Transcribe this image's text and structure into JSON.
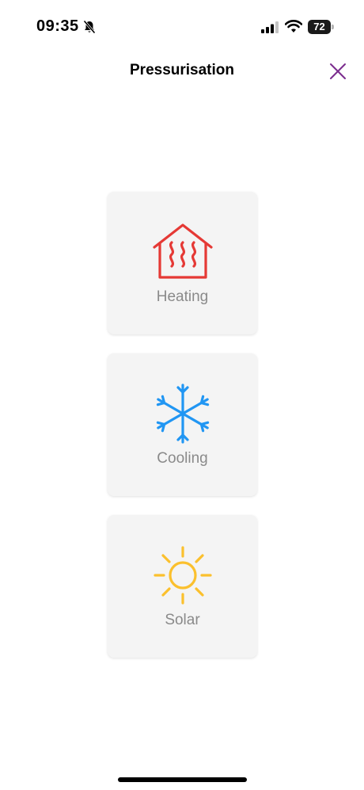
{
  "status_bar": {
    "time": "09:35",
    "battery_level": "72",
    "icons": [
      "bell-slash-icon",
      "signal-icon",
      "wifi-icon",
      "battery-icon"
    ]
  },
  "header": {
    "title": "Pressurisation",
    "close_icon": "close-icon"
  },
  "options": [
    {
      "label": "Heating",
      "icon": "house-heat-icon",
      "color": "#e53935"
    },
    {
      "label": "Cooling",
      "icon": "snowflake-icon",
      "color": "#2196f3"
    },
    {
      "label": "Solar",
      "icon": "sun-icon",
      "color": "#fbc02d"
    }
  ],
  "colors": {
    "accent": "#7b2d8e",
    "card_background": "#f4f4f4",
    "label_text": "#8a8a8a"
  }
}
